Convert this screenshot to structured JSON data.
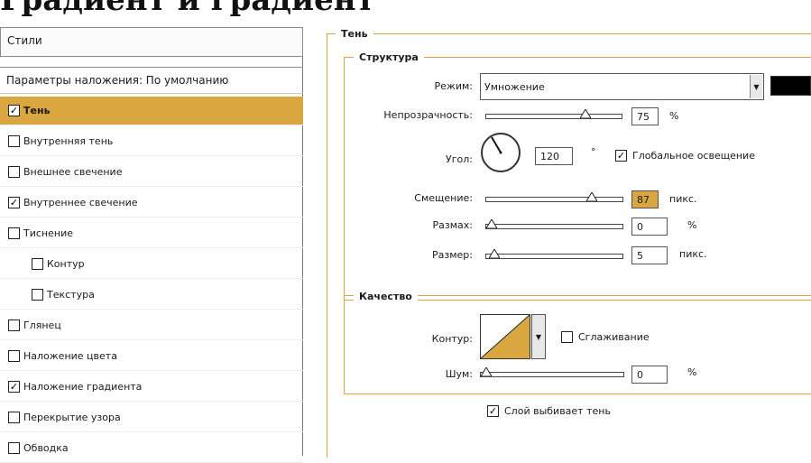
{
  "page": {
    "top_heading": "Градиент и градиент"
  },
  "left_panel": {
    "styles_header": "Стили",
    "blending_options": "Параметры наложения: По умолчанию",
    "items": [
      {
        "label": "Тень",
        "checked": true,
        "selected": true,
        "indent": false
      },
      {
        "label": "Внутренняя тень",
        "checked": false,
        "selected": false,
        "indent": false
      },
      {
        "label": "Внешнее свечение",
        "checked": false,
        "selected": false,
        "indent": false
      },
      {
        "label": "Внутреннее свечение",
        "checked": true,
        "selected": false,
        "indent": false
      },
      {
        "label": "Тиснение",
        "checked": false,
        "selected": false,
        "indent": false
      },
      {
        "label": "Контур",
        "checked": false,
        "selected": false,
        "indent": true
      },
      {
        "label": "Текстура",
        "checked": false,
        "selected": false,
        "indent": true
      },
      {
        "label": "Глянец",
        "checked": false,
        "selected": false,
        "indent": false
      },
      {
        "label": "Наложение цвета",
        "checked": false,
        "selected": false,
        "indent": false
      },
      {
        "label": "Наложение градиента",
        "checked": true,
        "selected": false,
        "indent": false
      },
      {
        "label": "Перекрытие узора",
        "checked": false,
        "selected": false,
        "indent": false
      },
      {
        "label": "Обводка",
        "checked": false,
        "selected": false,
        "indent": false
      }
    ]
  },
  "shadow": {
    "section_title": "Тень",
    "structure": {
      "title": "Структура",
      "mode_label": "Режим:",
      "mode_value": "Умножение",
      "mode_color": "#000000",
      "opacity_label": "Непрозрачность:",
      "opacity_value": "75",
      "opacity_unit": "%",
      "opacity_level": 0.75,
      "angle_label": "Угол:",
      "angle_value": "120",
      "angle_unit": "°",
      "global_light_label": "Глобальное освещение",
      "global_light_checked": true,
      "distance_label": "Смещение:",
      "distance_value": "87",
      "distance_unit": "пикс.",
      "distance_level": 0.8,
      "spread_label": "Размах:",
      "spread_value": "0",
      "spread_unit": "%",
      "spread_level": 0,
      "size_label": "Размер:",
      "size_value": "5",
      "size_unit": "пикс.",
      "size_level": 0.02
    },
    "quality": {
      "title": "Качество",
      "contour_label": "Контур:",
      "antialias_label": "Сглаживание",
      "antialias_checked": false,
      "noise_label": "Шум:",
      "noise_value": "0",
      "noise_unit": "%",
      "noise_level": 0
    },
    "knockout_label": "Слой выбивает тень",
    "knockout_checked": true
  },
  "colors": {
    "accent": "#d9a640",
    "border": "#8a8a8a"
  },
  "icons": {
    "check": "checkmark-icon",
    "dropdown": "chevron-down-icon",
    "slider": "triangle-thumb-icon"
  }
}
